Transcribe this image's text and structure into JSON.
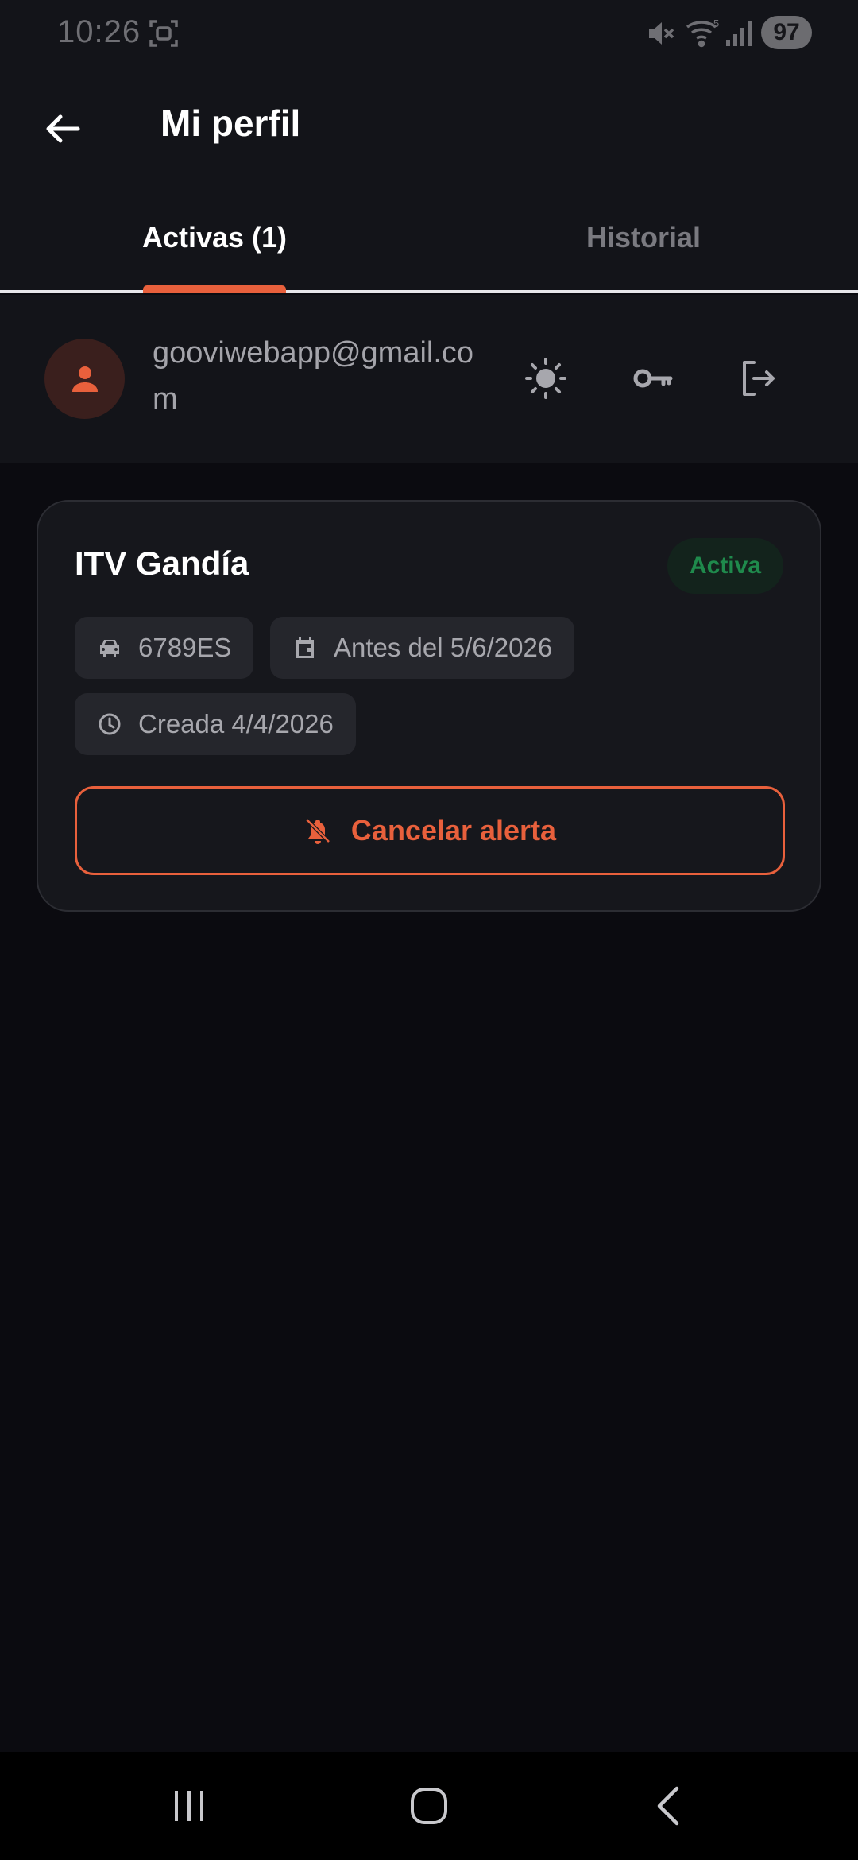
{
  "status_bar": {
    "time": "10:26",
    "battery": "97"
  },
  "header": {
    "title": "Mi perfil"
  },
  "tabs": [
    {
      "label": "Activas (1)",
      "active": true
    },
    {
      "label": "Historial",
      "active": false
    }
  ],
  "profile": {
    "email": "gooviwebapp@gmail.com"
  },
  "alert_card": {
    "title": "ITV Gandía",
    "status": "Activa",
    "plate": "6789ES",
    "deadline": "Antes del 5/6/2026",
    "created": "Creada 4/4/2026",
    "cancel_label": "Cancelar alerta"
  },
  "colors": {
    "accent": "#e8603c",
    "active_green": "#1f8a4c",
    "background": "#0b0b10",
    "surface": "#131419"
  },
  "icons": {
    "back": "arrow-left-icon",
    "avatar": "person-icon",
    "theme": "sun-icon",
    "key": "key-icon",
    "logout": "logout-icon",
    "plate": "car-icon",
    "deadline": "calendar-icon",
    "created": "clock-icon",
    "cancel": "bell-off-icon"
  }
}
